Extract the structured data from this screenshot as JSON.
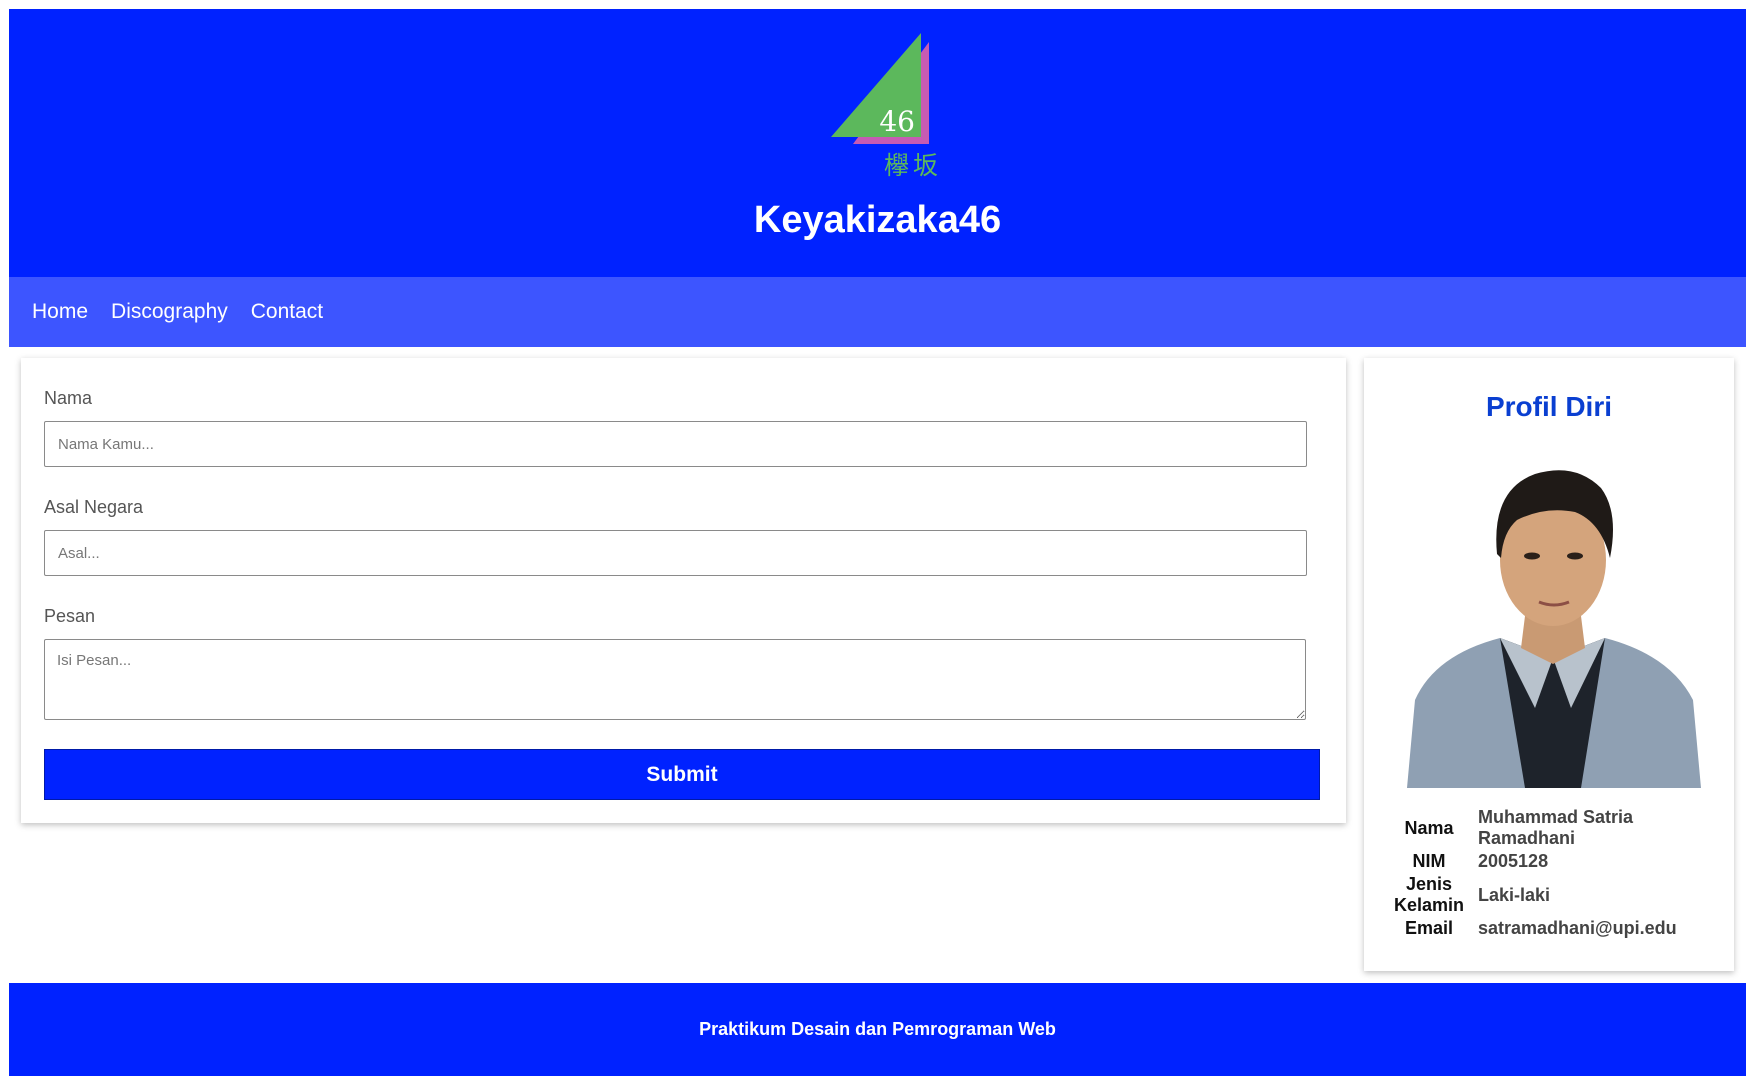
{
  "header": {
    "logo_number": "46",
    "logo_kanji": "欅坂",
    "title": "Keyakizaka46"
  },
  "nav": {
    "items": [
      {
        "label": "Home"
      },
      {
        "label": "Discography"
      },
      {
        "label": "Contact"
      }
    ]
  },
  "form": {
    "nama_label": "Nama",
    "nama_placeholder": "Nama Kamu...",
    "negara_label": "Asal Negara",
    "negara_placeholder": "Asal...",
    "pesan_label": "Pesan",
    "pesan_placeholder": "Isi Pesan...",
    "submit_label": "Submit"
  },
  "profile": {
    "title": "Profil Diri",
    "rows": [
      {
        "key": "Nama",
        "value": "Muhammad Satria Ramadhani"
      },
      {
        "key": "NIM",
        "value": "2005128"
      },
      {
        "key": "Jenis Kelamin",
        "value": "Laki-laki"
      },
      {
        "key": "Email",
        "value": "satramadhani@upi.edu"
      }
    ]
  },
  "footer": {
    "text": "Praktikum Desain dan Pemrograman Web"
  },
  "colors": {
    "header_bg": "#0022ff",
    "nav_bg": "#3d55ff",
    "accent": "#0a3fd1",
    "logo_green": "#5cb85c",
    "logo_pink": "#c65bb3"
  }
}
